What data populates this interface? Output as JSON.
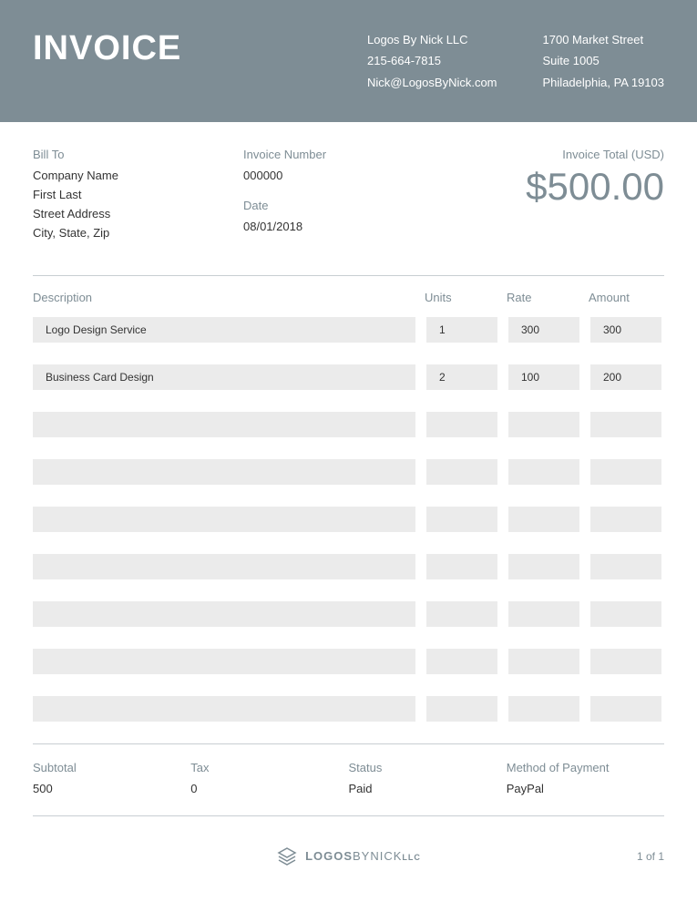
{
  "header": {
    "title": "INVOICE",
    "company": {
      "name": "Logos By Nick LLC",
      "phone": "215-664-7815",
      "email": "Nick@LogosByNick.com"
    },
    "address": {
      "street": "1700 Market Street",
      "suite": "Suite 1005",
      "city": "Philadelphia, PA 19103"
    }
  },
  "billTo": {
    "label": "Bill To",
    "company": "Company Name",
    "name": "First Last",
    "street": "Street Address",
    "city": "City, State, Zip"
  },
  "invoice": {
    "numberLabel": "Invoice Number",
    "number": "000000",
    "dateLabel": "Date",
    "date": "08/01/2018"
  },
  "total": {
    "label": "Invoice Total (USD)",
    "value": "$500.00"
  },
  "columns": {
    "description": "Description",
    "units": "Units",
    "rate": "Rate",
    "amount": "Amount"
  },
  "items": [
    {
      "desc": "Logo Design Service",
      "units": "1",
      "rate": "300",
      "amount": "300"
    },
    {
      "desc": "Business Card Design",
      "units": "2",
      "rate": "100",
      "amount": "200"
    },
    {
      "desc": "",
      "units": "",
      "rate": "",
      "amount": ""
    },
    {
      "desc": "",
      "units": "",
      "rate": "",
      "amount": ""
    },
    {
      "desc": "",
      "units": "",
      "rate": "",
      "amount": ""
    },
    {
      "desc": "",
      "units": "",
      "rate": "",
      "amount": ""
    },
    {
      "desc": "",
      "units": "",
      "rate": "",
      "amount": ""
    },
    {
      "desc": "",
      "units": "",
      "rate": "",
      "amount": ""
    },
    {
      "desc": "",
      "units": "",
      "rate": "",
      "amount": ""
    }
  ],
  "summary": {
    "subtotalLabel": "Subtotal",
    "subtotal": "500",
    "taxLabel": "Tax",
    "tax": "0",
    "statusLabel": "Status",
    "status": "Paid",
    "methodLabel": "Method of Payment",
    "method": "PayPal"
  },
  "footer": {
    "brand1": "LOGOS",
    "brand2": "BYNICK",
    "brand3": "LLC",
    "page": "1 of 1"
  }
}
